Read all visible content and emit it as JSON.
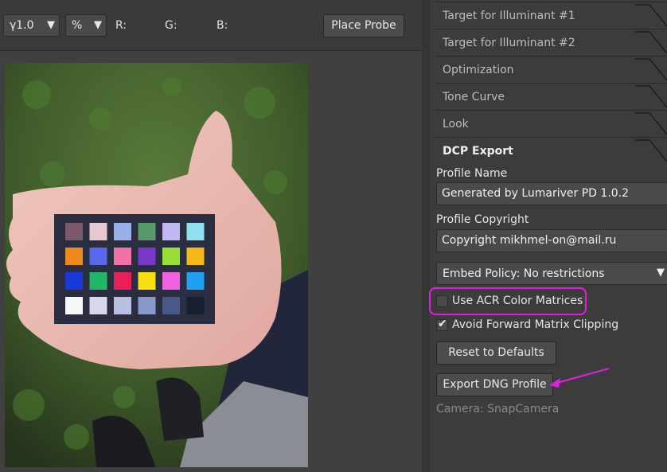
{
  "toolbar": {
    "gamma_value": "γ1.0",
    "unit_value": "%",
    "r_label": "R:",
    "g_label": "G:",
    "b_label": "B:",
    "place_probe_label": "Place Probe"
  },
  "panel": {
    "sections": [
      {
        "label": "Target for Illuminant #1",
        "active": false
      },
      {
        "label": "Target for Illuminant #2",
        "active": false
      },
      {
        "label": "Optimization",
        "active": false
      },
      {
        "label": "Tone Curve",
        "active": false
      },
      {
        "label": "Look",
        "active": false
      },
      {
        "label": "DCP Export",
        "active": true
      }
    ],
    "profile_name_label": "Profile Name",
    "profile_name_value": "Generated by Lumariver PD 1.0.2",
    "profile_copyright_label": "Profile Copyright",
    "profile_copyright_value": "Copyright mikhmel-on@mail.ru",
    "embed_policy_value": "Embed Policy: No restrictions",
    "use_acr_label": "Use ACR Color Matrices",
    "use_acr_checked": false,
    "avoid_forward_label": "Avoid Forward Matrix Clipping",
    "avoid_forward_checked": true,
    "reset_label": "Reset to Defaults",
    "export_label": "Export DNG Profile",
    "camera_text": "Camera: SnapCamera"
  },
  "colors": {
    "annotation": "#e020e0",
    "chart_patches": [
      [
        "#7a5a6a",
        "#e8c8d0",
        "#98b0e8",
        "#5a9a6a",
        "#c0b8f0",
        "#90e0f0"
      ],
      [
        "#f08820",
        "#5868e8",
        "#f070a8",
        "#7838c8",
        "#98e038",
        "#f8b818"
      ],
      [
        "#1838d8",
        "#20b868",
        "#e82058",
        "#f8e010",
        "#f060e0",
        "#20a0f0"
      ],
      [
        "#f8f8f8",
        "#d8d8e8",
        "#b8c0e0",
        "#8898c8",
        "#485888",
        "#182030"
      ]
    ]
  }
}
